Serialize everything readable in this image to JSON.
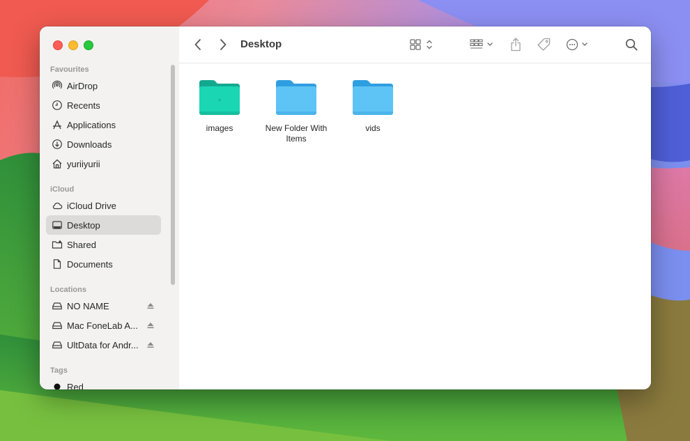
{
  "window": {
    "title": "Desktop"
  },
  "sidebar": {
    "sections": [
      {
        "title": "Favourites",
        "items": [
          {
            "label": "AirDrop",
            "icon": "airdrop-icon"
          },
          {
            "label": "Recents",
            "icon": "clock-icon"
          },
          {
            "label": "Applications",
            "icon": "applications-icon"
          },
          {
            "label": "Downloads",
            "icon": "download-icon"
          },
          {
            "label": "yuriiyurii",
            "icon": "home-icon"
          }
        ]
      },
      {
        "title": "iCloud",
        "items": [
          {
            "label": "iCloud Drive",
            "icon": "cloud-icon"
          },
          {
            "label": "Desktop",
            "icon": "desktop-icon",
            "selected": true
          },
          {
            "label": "Shared",
            "icon": "shared-folder-icon"
          },
          {
            "label": "Documents",
            "icon": "document-icon"
          }
        ]
      },
      {
        "title": "Locations",
        "items": [
          {
            "label": "NO NAME",
            "icon": "drive-icon",
            "ejectable": true
          },
          {
            "label": "Mac FoneLab A...",
            "icon": "drive-icon",
            "ejectable": true
          },
          {
            "label": "UltData for Andr...",
            "icon": "drive-icon",
            "ejectable": true
          }
        ]
      },
      {
        "title": "Tags",
        "items": [
          {
            "label": "Red",
            "icon": "tag-dot-icon"
          }
        ]
      }
    ]
  },
  "toolbar": {
    "back": "chevron-left-icon",
    "forward": "chevron-right-icon",
    "view_mode": "grid-view-icon",
    "group": "group-icon",
    "share": "share-icon",
    "tag": "tag-icon",
    "more": "more-icon",
    "search": "search-icon"
  },
  "content": {
    "items": [
      {
        "label": "images",
        "color": "#1ad6b3"
      },
      {
        "label": "New Folder With Items",
        "color": "#5ec4f5"
      },
      {
        "label": "vids",
        "color": "#5ec4f5"
      }
    ]
  },
  "colors": {
    "selection": "#dcdbda",
    "folder_blue": "#5ec4f5",
    "folder_teal": "#1ad6b3"
  }
}
